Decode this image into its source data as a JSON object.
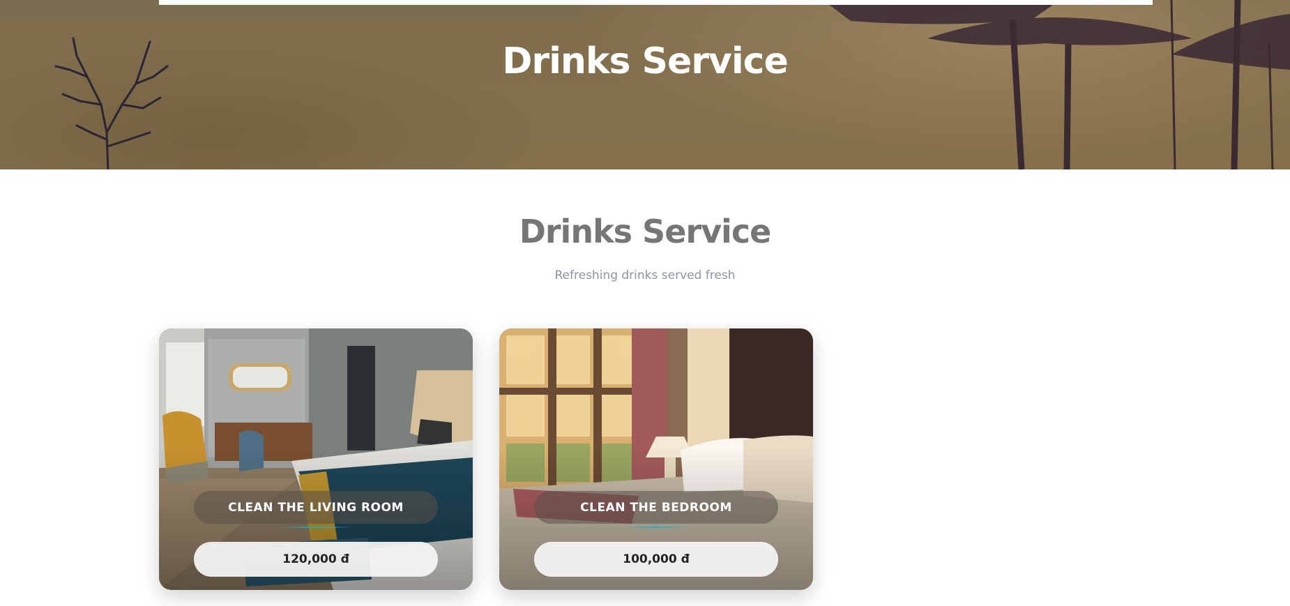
{
  "hero": {
    "title": "Drinks Service"
  },
  "section": {
    "title": "Drinks Service",
    "subtitle": "Refreshing drinks served fresh"
  },
  "cards": [
    {
      "label": "CLEAN THE LIVING ROOM",
      "price": "120,000 đ",
      "image": "hotel-living-room-photo"
    },
    {
      "label": "CLEAN THE BEDROOM",
      "price": "100,000 đ",
      "image": "hotel-bedroom-photo"
    }
  ],
  "colors": {
    "hero_overlay": "#836f4c",
    "section_title": "#767676",
    "subtitle": "#8a94a6",
    "accent_line": "#00bcd4"
  }
}
